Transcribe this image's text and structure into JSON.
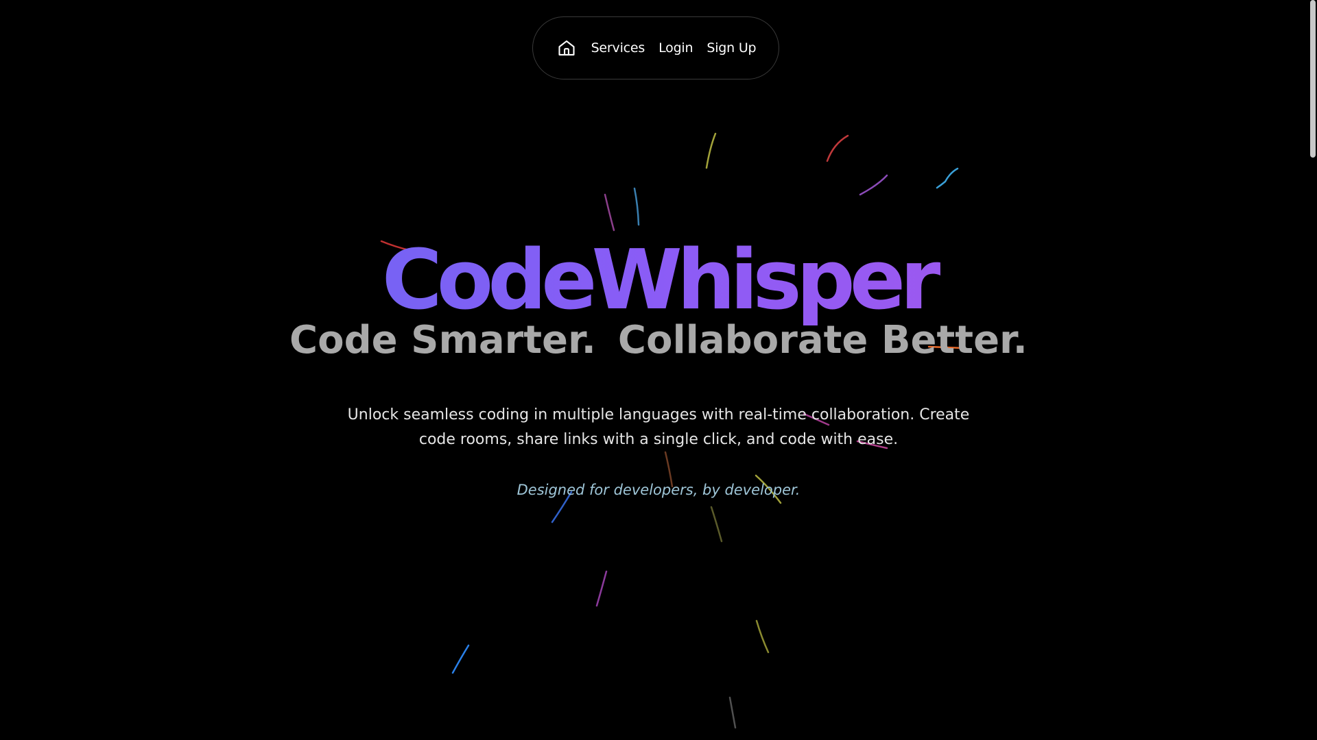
{
  "navbar": {
    "home_icon": "home-icon",
    "links": [
      "Services",
      "Login",
      "Sign Up"
    ]
  },
  "hero": {
    "title": "CodeWhisper",
    "tagline_part1": "Code Smarter.",
    "tagline_part2": "Collaborate Better.",
    "description": "Unlock seamless coding in multiple languages with real-time collaboration. Create code rooms, share links with a single click, and code with ease.",
    "signature": "Designed for developers, by developer."
  },
  "colors": {
    "background": "#000000",
    "title_gradient_start": "#5b6cf0",
    "title_gradient_end": "#b155e8",
    "tagline": "#a9a9a9",
    "description": "#e6e6e6",
    "signature": "#9fc6d8",
    "nav_border": "#3a3a3a"
  }
}
